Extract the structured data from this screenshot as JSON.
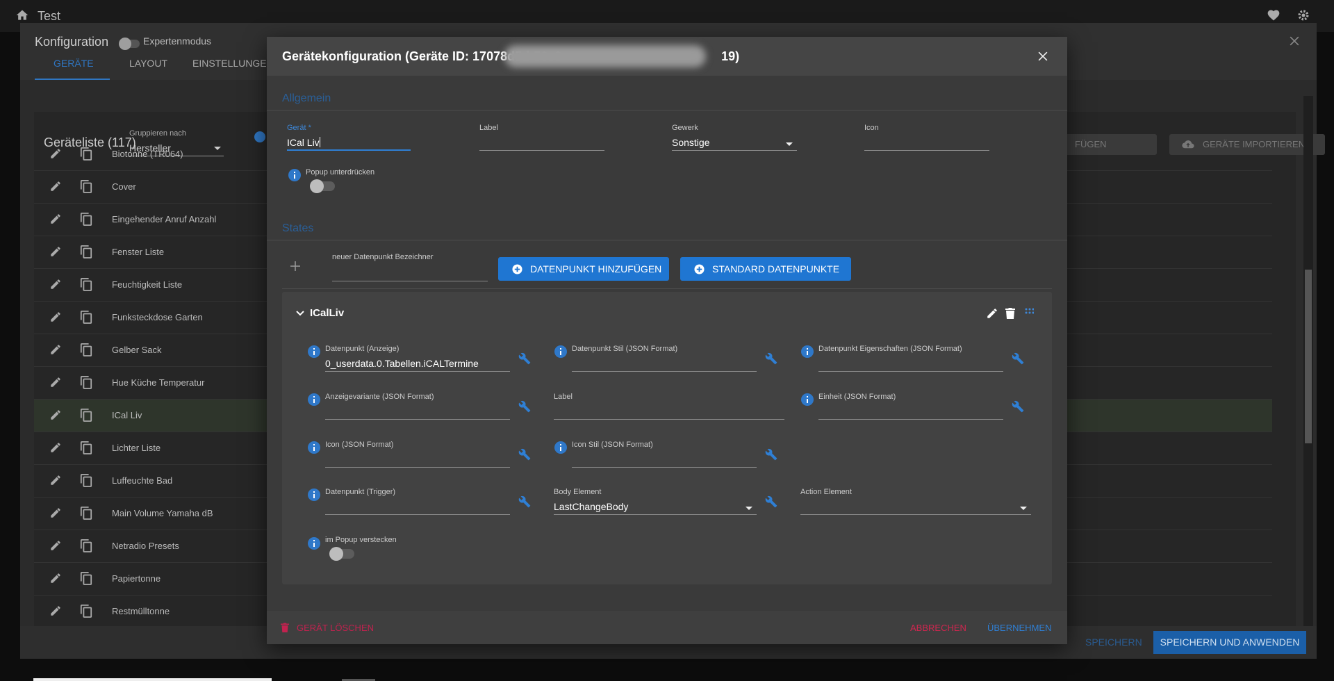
{
  "app": {
    "title": "Test"
  },
  "config": {
    "title": "Konfiguration",
    "expert_mode_label": "Expertenmodus",
    "tabs": [
      {
        "label": "GERÄTE",
        "active": true
      },
      {
        "label": "LAYOUT",
        "active": false
      },
      {
        "label": "EINSTELLUNGEN",
        "active": false
      }
    ],
    "device_list": {
      "title": "Geräteliste (117)",
      "group_by_label": "Gruppieren nach",
      "group_by_value": "Hersteller",
      "add_button_label": "FÜGEN",
      "import_button_label": "GERÄTE IMPORTIEREN",
      "devices": [
        {
          "name": "Biotonne (TR064)"
        },
        {
          "name": "Cover"
        },
        {
          "name": "Eingehender Anruf Anzahl"
        },
        {
          "name": "Fenster Liste"
        },
        {
          "name": "Feuchtigkeit Liste"
        },
        {
          "name": "Funksteckdose Garten"
        },
        {
          "name": "Gelber Sack"
        },
        {
          "name": "Hue Küche Temperatur"
        },
        {
          "name": "ICal Liv",
          "highlighted": true
        },
        {
          "name": "Lichter Liste"
        },
        {
          "name": "Luffeuchte Bad"
        },
        {
          "name": "Main Volume Yamaha dB"
        },
        {
          "name": "Netradio Presets"
        },
        {
          "name": "Papiertonne"
        },
        {
          "name": "Restmülltonne"
        }
      ]
    },
    "footer": {
      "save_label": "SPEICHERN",
      "save_apply_label": "SPEICHERN UND ANWENDEN"
    }
  },
  "modal": {
    "title": "Gerätekonfiguration (Geräte ID: 17078d5d-56e0-",
    "title_suffix": "19)",
    "general": {
      "section_title": "Allgemein",
      "device_label": "Gerät *",
      "device_value": "ICal Liv",
      "label_label": "Label",
      "label_value": "",
      "trade_label": "Gewerk",
      "trade_value": "Sonstige",
      "icon_label": "Icon",
      "icon_value": "",
      "popup_suppress_label": "Popup unterdrücken"
    },
    "states": {
      "section_title": "States",
      "new_datapoint_label": "neuer Datenpunkt Bezeichner",
      "new_datapoint_value": "",
      "add_datapoint_button": "DATENPUNKT HINZUFÜGEN",
      "default_datapoints_button": "STANDARD DATENPUNKTE",
      "state": {
        "name": "ICalLiv",
        "fields": {
          "dp_display_label": "Datenpunkt (Anzeige)",
          "dp_display_value": "0_userdata.0.Tabellen.iCALTermine",
          "dp_style_label": "Datenpunkt Stil (JSON Format)",
          "dp_style_value": "",
          "dp_props_label": "Datenpunkt Eigenschaften (JSON Format)",
          "dp_props_value": "",
          "display_variant_label": "Anzeigevariante (JSON Format)",
          "display_variant_value": "",
          "label_label": "Label",
          "label_value": "",
          "unit_label": "Einheit (JSON Format)",
          "unit_value": "",
          "icon_label": "Icon (JSON Format)",
          "icon_value": "",
          "icon_style_label": "Icon Stil (JSON Format)",
          "icon_style_value": "",
          "dp_trigger_label": "Datenpunkt (Trigger)",
          "dp_trigger_value": "",
          "body_element_label": "Body Element",
          "body_element_value": "LastChangeBody",
          "action_element_label": "Action Element",
          "action_element_value": "",
          "hide_in_popup_label": "im Popup verstecken"
        }
      }
    },
    "footer": {
      "delete_label": "GERÄT LÖSCHEN",
      "cancel_label": "ABBRECHEN",
      "apply_label": "ÜBERNEHMEN"
    }
  },
  "colors": {
    "accent": "#1f76d2",
    "danger": "#d0264f",
    "background": "#3a3a3a"
  }
}
